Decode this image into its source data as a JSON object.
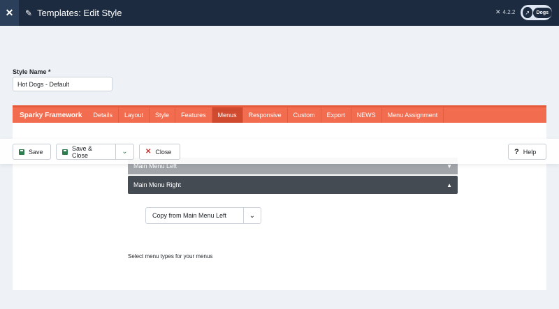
{
  "header": {
    "title": "Templates: Edit Style",
    "version": "4.2.2",
    "user_label": "Dogs"
  },
  "style_name": {
    "label": "Style Name *",
    "value": "Hot Dogs - Default"
  },
  "tabs": {
    "brand": "Sparky Framework",
    "items": [
      {
        "label": "Details"
      },
      {
        "label": "Layout"
      },
      {
        "label": "Style"
      },
      {
        "label": "Features"
      },
      {
        "label": "Menus"
      },
      {
        "label": "Responsive"
      },
      {
        "label": "Custom"
      },
      {
        "label": "Export"
      },
      {
        "label": "NEWS"
      },
      {
        "label": "Menu Assignment"
      }
    ],
    "active": "Menus"
  },
  "toolbar": {
    "save_label": "Save",
    "save_close_label": "Save & Close",
    "close_label": "Close",
    "help_label": "Help"
  },
  "menus": {
    "left_label": "Main Menu Left",
    "right_label": "Main Menu Right",
    "copy_select_value": "Copy from Main Menu Left",
    "hint": "Select menu types for your menus"
  },
  "colors": {
    "header_bg": "#1c2b3f",
    "tab_accent": "#f26c4f",
    "tab_active": "#cf4a2e",
    "save_icon": "#2e7d4f",
    "close_icon": "#c9302c"
  },
  "icons": {
    "logo": "joomla-logo-icon",
    "title": "brush-icon",
    "user": "external-link-icon"
  }
}
